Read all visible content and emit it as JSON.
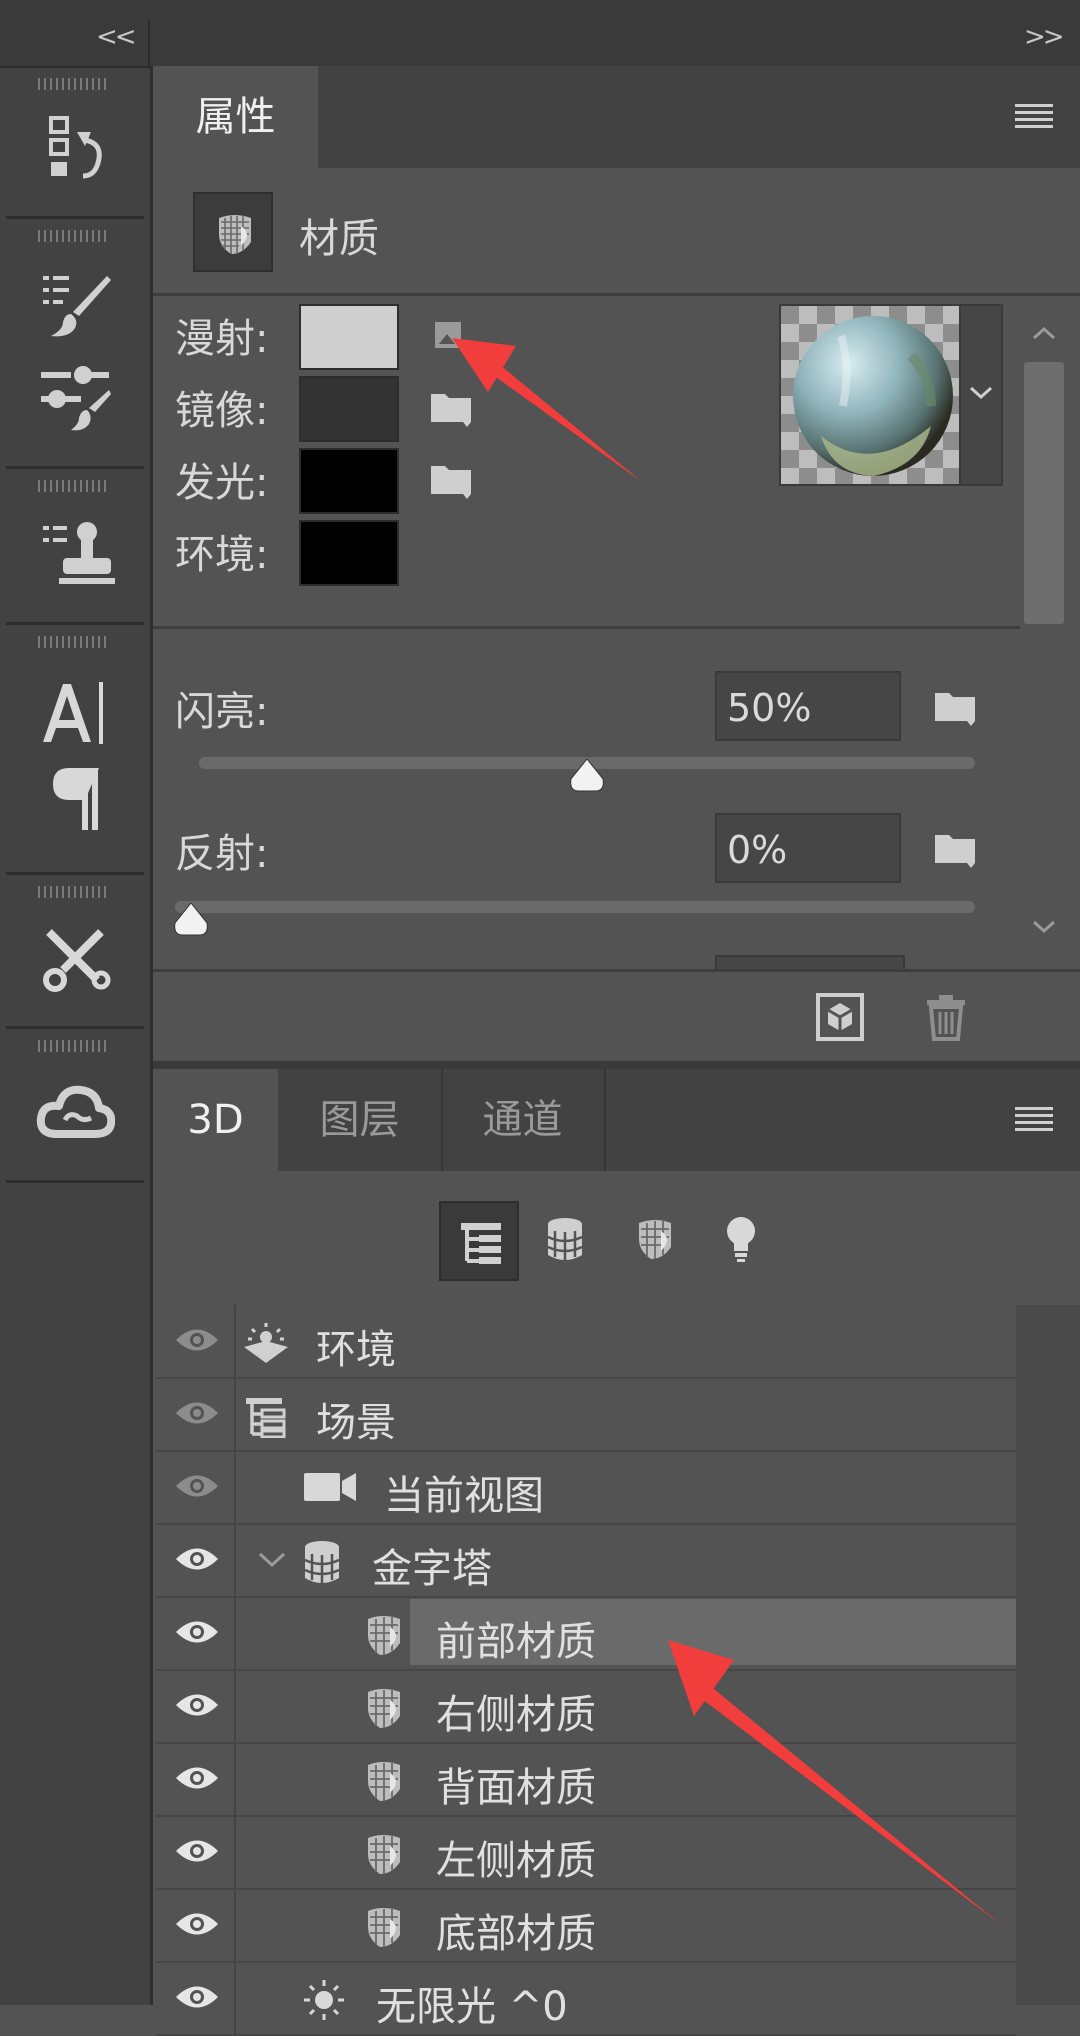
{
  "topbar": {
    "collapse_left": "<<",
    "collapse_right": ">>"
  },
  "properties_panel": {
    "tab_label": "属性",
    "header_label": "材质",
    "material_rows": [
      {
        "label": "漫射:",
        "swatch_color": "#cfcfcf",
        "has_folder": true,
        "folder_has_texture": true
      },
      {
        "label": "镜像:",
        "swatch_color": "#333333",
        "has_folder": true,
        "folder_has_texture": false
      },
      {
        "label": "发光:",
        "swatch_color": "#000000",
        "has_folder": true,
        "folder_has_texture": false
      },
      {
        "label": "环境:",
        "swatch_color": "#000000",
        "has_folder": false,
        "folder_has_texture": false
      }
    ],
    "shine": {
      "label": "闪亮:",
      "value": "50%",
      "fraction": 0.5
    },
    "reflection": {
      "label": "反射:",
      "value": "0%",
      "fraction": 0.0
    }
  },
  "layers_panel": {
    "tabs": [
      {
        "label": "3D",
        "active": true
      },
      {
        "label": "图层",
        "active": false
      },
      {
        "label": "通道",
        "active": false
      }
    ],
    "filter_icons": [
      "scene-filter-icon",
      "mesh-filter-icon",
      "material-filter-icon",
      "light-filter-icon"
    ],
    "rows": [
      {
        "label": "环境",
        "icon": "environment-icon",
        "eye": "dim",
        "selected": false
      },
      {
        "label": "场景",
        "icon": "scene-icon",
        "eye": "dim",
        "selected": false
      },
      {
        "label": "当前视图",
        "icon": "camera-icon",
        "eye": "dim",
        "selected": false
      },
      {
        "label": "金字塔",
        "icon": "mesh-icon",
        "eye": "on",
        "selected": false,
        "expanded": true
      },
      {
        "label": "前部材质",
        "icon": "material-icon",
        "eye": "on",
        "selected": true
      },
      {
        "label": "右侧材质",
        "icon": "material-icon",
        "eye": "on",
        "selected": false
      },
      {
        "label": "背面材质",
        "icon": "material-icon",
        "eye": "on",
        "selected": false
      },
      {
        "label": "左侧材质",
        "icon": "material-icon",
        "eye": "on",
        "selected": false
      },
      {
        "label": "底部材质",
        "icon": "material-icon",
        "eye": "on",
        "selected": false
      },
      {
        "label": "无限光 ^0",
        "icon": "infinite-light-icon",
        "eye": "on",
        "selected": false
      }
    ]
  },
  "colors": {
    "annotation_arrow": "#f23d3d",
    "panel_bg": "#535353",
    "dark_bg": "#424242"
  }
}
